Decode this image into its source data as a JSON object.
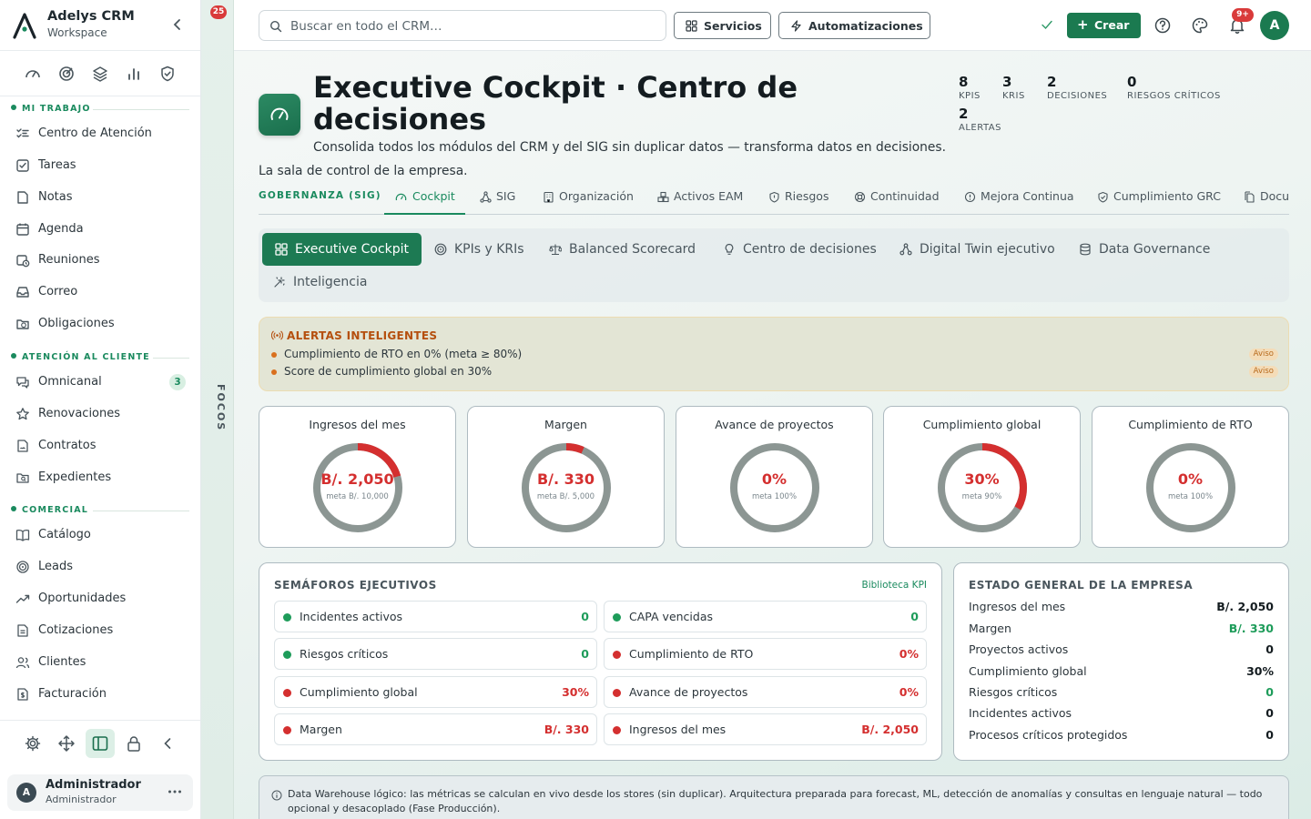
{
  "sidebar": {
    "brand_name": "Adelys CRM",
    "brand_sub": "Workspace",
    "sections": [
      {
        "label": "MI TRABAJO"
      },
      {
        "label": "ATENCIÓN AL CLIENTE"
      },
      {
        "label": "COMERCIAL"
      }
    ],
    "items": [
      {
        "label": "Centro de Atención",
        "icon": "list-check-icon"
      },
      {
        "label": "Tareas",
        "icon": "checkbox-icon"
      },
      {
        "label": "Notas",
        "icon": "note-icon"
      },
      {
        "label": "Agenda",
        "icon": "calendar-icon"
      },
      {
        "label": "Reuniones",
        "icon": "calendar-clock-icon"
      },
      {
        "label": "Correo",
        "icon": "inbox-icon"
      },
      {
        "label": "Obligaciones",
        "icon": "folder-clock-icon"
      },
      {
        "label": "Omnicanal",
        "icon": "chat-icon",
        "badge": "3"
      },
      {
        "label": "Renovaciones",
        "icon": "star-icon"
      },
      {
        "label": "Contratos",
        "icon": "contract-icon"
      },
      {
        "label": "Expedientes",
        "icon": "folder-search-icon"
      },
      {
        "label": "Catálogo",
        "icon": "book-icon"
      },
      {
        "label": "Leads",
        "icon": "target-icon"
      },
      {
        "label": "Oportunidades",
        "icon": "trend-icon"
      },
      {
        "label": "Cotizaciones",
        "icon": "document-icon"
      },
      {
        "label": "Clientes",
        "icon": "users-icon"
      },
      {
        "label": "Facturación",
        "icon": "invoice-icon"
      }
    ],
    "user": {
      "initial": "A",
      "name": "Administrador",
      "role": "Administrador"
    }
  },
  "focus_rail": {
    "badge": "25",
    "label": "FOCOS"
  },
  "topbar": {
    "search_placeholder": "Buscar en todo el CRM…",
    "services_label": "Servicios",
    "automations_label": "Automatizaciones",
    "create_label": "Crear",
    "notifications_badge": "9+",
    "avatar_initial": "A"
  },
  "header": {
    "title": "Executive Cockpit · Centro de decisiones",
    "description": "Consolida todos los módulos del CRM y del SIG sin duplicar datos — transforma datos en decisiones.",
    "description_2": "La sala de control de la empresa.",
    "stats": [
      {
        "value": "8",
        "label": "KPIs"
      },
      {
        "value": "3",
        "label": "KRIs"
      },
      {
        "value": "2",
        "label": "Decisiones"
      },
      {
        "value": "0",
        "label": "Riesgos críticos"
      },
      {
        "value": "2",
        "label": "Alertas"
      }
    ]
  },
  "module_tabs": {
    "group_label": "GOBERNANZA (SIG)",
    "tabs": [
      {
        "label": "Cockpit",
        "icon": "gauge-icon",
        "active": true
      },
      {
        "label": "SIG",
        "icon": "network-icon"
      },
      {
        "label": "Organización",
        "icon": "building-icon"
      },
      {
        "label": "Activos EAM",
        "icon": "boxes-icon"
      },
      {
        "label": "Riesgos",
        "icon": "shield-icon"
      },
      {
        "label": "Continuidad",
        "icon": "lifebuoy-icon"
      },
      {
        "label": "Mejora Continua",
        "icon": "alert-circle-icon"
      },
      {
        "label": "Cumplimiento GRC",
        "icon": "shield-check-icon"
      },
      {
        "label": "Docu",
        "icon": "files-icon"
      }
    ]
  },
  "sub_tabs": [
    {
      "label": "Executive Cockpit",
      "icon": "grid-icon",
      "active": true
    },
    {
      "label": "KPIs y KRIs",
      "icon": "target-icon"
    },
    {
      "label": "Balanced Scorecard",
      "icon": "scale-icon"
    },
    {
      "label": "Centro de decisiones",
      "icon": "lightbulb-icon"
    },
    {
      "label": "Digital Twin ejecutivo",
      "icon": "network-icon"
    },
    {
      "label": "Data Governance",
      "icon": "database-icon"
    },
    {
      "label": "Inteligencia",
      "icon": "sparkles-icon"
    }
  ],
  "alerts": {
    "title": "ALERTAS INTELIGENTES",
    "items": [
      {
        "text": "Cumplimiento de RTO en 0% (meta ≥ 80%)",
        "tag": "Aviso"
      },
      {
        "text": "Score de cumplimiento global en 30%",
        "tag": "Aviso"
      }
    ]
  },
  "gauges": [
    {
      "title": "Ingresos del mes",
      "value": "B/. 2,050",
      "meta": "meta B/. 10,000",
      "fraction": 0.205
    },
    {
      "title": "Margen",
      "value": "B/. 330",
      "meta": "meta B/. 5,000",
      "fraction": 0.066
    },
    {
      "title": "Avance de proyectos",
      "value": "0%",
      "meta": "meta 100%",
      "fraction": 0
    },
    {
      "title": "Cumplimiento global",
      "value": "30%",
      "meta": "meta 90%",
      "fraction": 0.333
    },
    {
      "title": "Cumplimiento de RTO",
      "value": "0%",
      "meta": "meta 100%",
      "fraction": 0
    }
  ],
  "semaforos": {
    "title": "SEMÁFOROS EJECUTIVOS",
    "link": "Biblioteca KPI",
    "items": [
      {
        "label": "Incidentes activos",
        "value": "0",
        "status": "green"
      },
      {
        "label": "CAPA vencidas",
        "value": "0",
        "status": "green"
      },
      {
        "label": "Riesgos críticos",
        "value": "0",
        "status": "green"
      },
      {
        "label": "Cumplimiento de RTO",
        "value": "0%",
        "status": "red"
      },
      {
        "label": "Cumplimiento global",
        "value": "30%",
        "status": "red"
      },
      {
        "label": "Avance de proyectos",
        "value": "0%",
        "status": "red"
      },
      {
        "label": "Margen",
        "value": "B/. 330",
        "status": "red"
      },
      {
        "label": "Ingresos del mes",
        "value": "B/. 2,050",
        "status": "red"
      }
    ]
  },
  "estado": {
    "title": "ESTADO GENERAL DE LA EMPRESA",
    "rows": [
      {
        "label": "Ingresos del mes",
        "value": "B/. 2,050",
        "tone": "dark"
      },
      {
        "label": "Margen",
        "value": "B/. 330",
        "tone": "green"
      },
      {
        "label": "Proyectos activos",
        "value": "0",
        "tone": "dark"
      },
      {
        "label": "Cumplimiento global",
        "value": "30%",
        "tone": "dark"
      },
      {
        "label": "Riesgos críticos",
        "value": "0",
        "tone": "green"
      },
      {
        "label": "Incidentes activos",
        "value": "0",
        "tone": "dark"
      },
      {
        "label": "Procesos críticos protegidos",
        "value": "0",
        "tone": "dark"
      }
    ]
  },
  "footnote": "Data Warehouse lógico: las métricas se calculan en vivo desde los stores (sin duplicar). Arquitectura preparada para forecast, ML, detección de anomalías y consultas en lenguaje natural — todo opcional y desacoplado (Fase Producción).",
  "colors": {
    "accent": "#1b7a50",
    "danger": "#d42f2f",
    "ok": "#1e9c5a",
    "warning": "#b54f0e"
  }
}
